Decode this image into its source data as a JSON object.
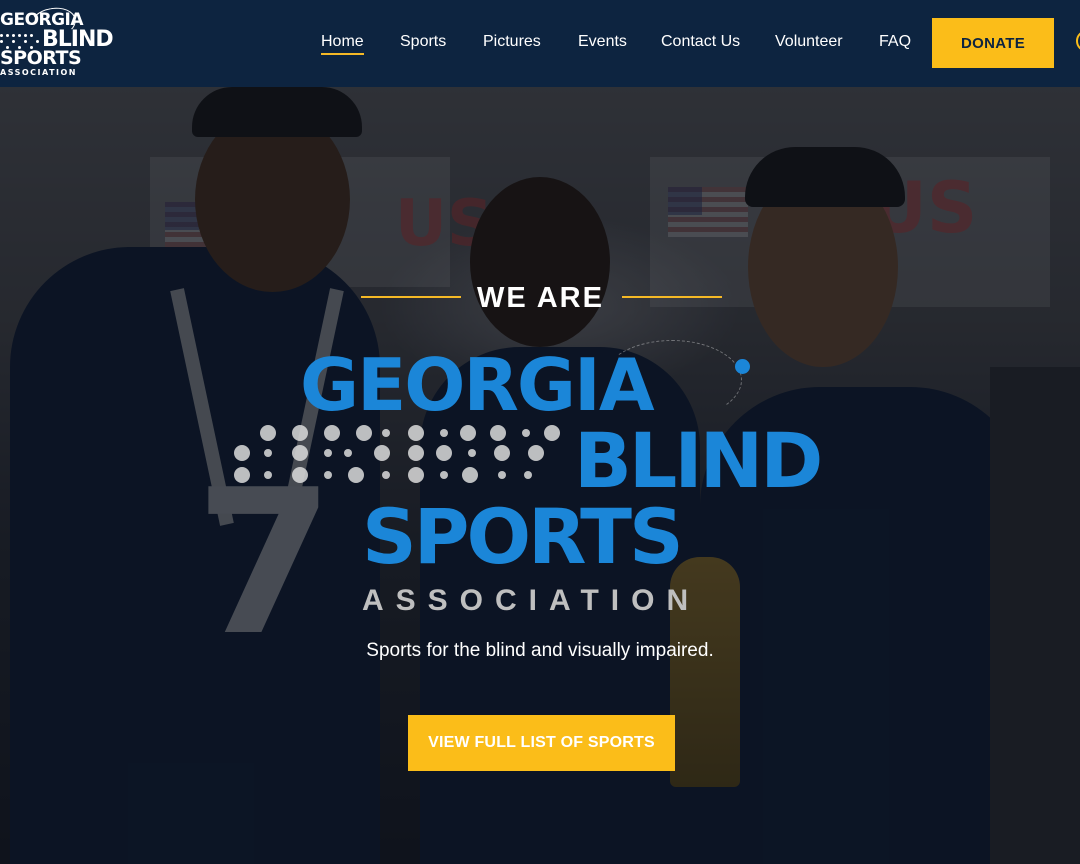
{
  "logo": {
    "line1": "GEORGIA",
    "line2": "BLIND",
    "line3": "SPORTS",
    "line4": "ASSOCIATION"
  },
  "nav": {
    "items": [
      {
        "label": "Home",
        "active": true
      },
      {
        "label": "Sports"
      },
      {
        "label": "Pictures"
      },
      {
        "label": "Events"
      },
      {
        "label": "Contact Us"
      },
      {
        "label": "Volunteer"
      },
      {
        "label": "FAQ"
      }
    ],
    "donate_label": "DONATE"
  },
  "hero": {
    "we_are": "WE ARE",
    "brand_georgia": "GEORGIA",
    "brand_blind": "BLIND",
    "brand_sports": "SPORTS",
    "brand_association": "ASSOCIATION",
    "tagline": "Sports for the blind and visually impaired.",
    "cta_label": "VIEW FULL LIST OF SPORTS"
  },
  "colors": {
    "header_bg": "#0d2440",
    "accent_yellow": "#fbbd19",
    "brand_blue": "#1b86d8",
    "association_gray": "#bfbfbf"
  }
}
